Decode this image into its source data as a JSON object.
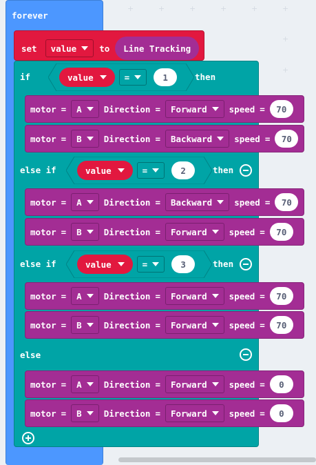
{
  "forever_label": "forever",
  "set_block": {
    "keyword": "set",
    "variable": "value",
    "to": "to",
    "sensor": "Line Tracking"
  },
  "if_label": "if",
  "then_label": "then",
  "else_if_label": "else if",
  "else_label": "else",
  "eq_symbol": "=",
  "motor_text": {
    "motor": "motor",
    "eq": "=",
    "direction": "Direction",
    "speed": "speed"
  },
  "conditions": [
    {
      "variable": "value",
      "value": "1"
    },
    {
      "variable": "value",
      "value": "2"
    },
    {
      "variable": "value",
      "value": "3"
    }
  ],
  "motors": [
    {
      "motor": "A",
      "direction": "Forward",
      "speed": "70"
    },
    {
      "motor": "B",
      "direction": "Backward",
      "speed": "70"
    },
    {
      "motor": "A",
      "direction": "Backward",
      "speed": "70"
    },
    {
      "motor": "B",
      "direction": "Forward",
      "speed": "70"
    },
    {
      "motor": "A",
      "direction": "Forward",
      "speed": "70"
    },
    {
      "motor": "B",
      "direction": "Forward",
      "speed": "70"
    },
    {
      "motor": "A",
      "direction": "Forward",
      "speed": "0"
    },
    {
      "motor": "B",
      "direction": "Forward",
      "speed": "0"
    }
  ],
  "icons": {
    "remove": "minus-circle-icon",
    "add": "plus-circle-icon",
    "dropdown": "caret-down-icon"
  },
  "colors": {
    "loops": "#4c97ff",
    "variables": "#e2183f",
    "logic": "#00a4a6",
    "motor": "#a32d94",
    "workspace": "#ecf0f4"
  }
}
